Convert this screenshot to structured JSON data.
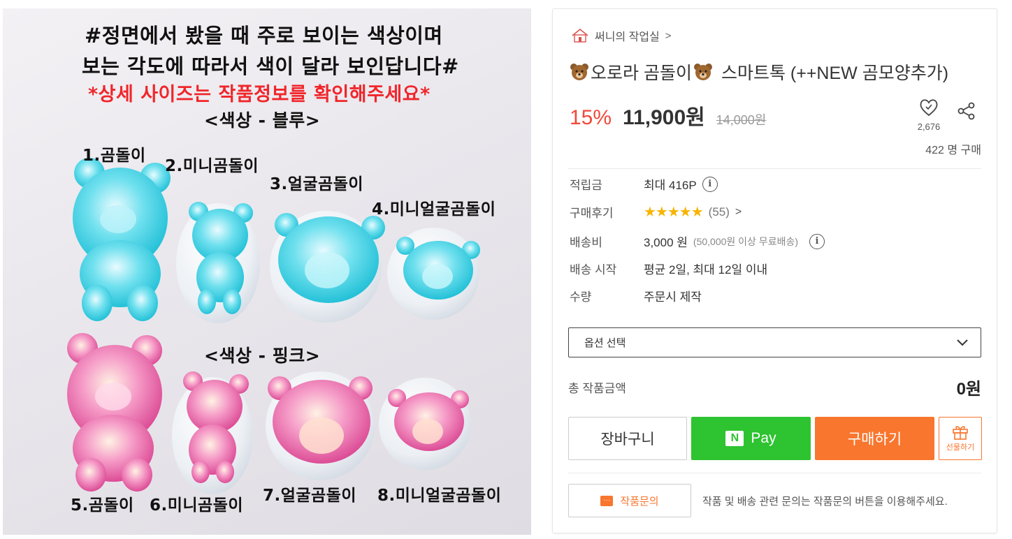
{
  "photo": {
    "line1": "#정면에서 봤을 때 주로 보이는 색상이며",
    "line2": "보는 각도에 따라서 색이 달라 보인답니다#",
    "line3": "*상세 사이즈는 작품정보를 확인해주세요*",
    "color_blue": "<색상 - 블루>",
    "color_pink": "<색상 - 핑크>",
    "labels": [
      "1.곰돌이",
      "2.미니곰돌이",
      "3.얼굴곰돌이",
      "4.미니얼굴곰돌이",
      "5.곰돌이",
      "6.미니곰돌이",
      "7.얼굴곰돌이",
      "8.미니얼굴곰돌이"
    ]
  },
  "shop": {
    "name": "써니의 작업실",
    "arrow": ">",
    "logo_icon": "house-logo-icon"
  },
  "product": {
    "title": "오로라 곰돌이",
    "title_suffix": "스마트톡 (++NEW 곰모양추가)",
    "discount": "15%",
    "price": "11,900원",
    "original_price": "14,000원",
    "likes": "2,676",
    "buyers": "422 명 구매"
  },
  "info": {
    "points_label": "적립금",
    "points_value": "최대 416P",
    "review_label": "구매후기",
    "review_stars": "★★★★★",
    "review_count": "(55)",
    "review_arrow": ">",
    "shipping_label": "배송비",
    "shipping_value": "3,000 원",
    "shipping_note": "(50,000원 이상 무료배송)",
    "dispatch_label": "배송 시작",
    "dispatch_value": "평균 2일, 최대 12일 이내",
    "qty_label": "수량",
    "qty_value": "주문시 제작"
  },
  "option_select": {
    "placeholder": "옵션 선택"
  },
  "total": {
    "label": "총 작품금액",
    "value": "0원"
  },
  "buttons": {
    "cart": "장바구니",
    "npay_n": "N",
    "npay": "Pay",
    "buy": "구매하기",
    "gift": "선물하기"
  },
  "inquiry": {
    "label": "작품문의",
    "note": "작품 및 배송 관련 문의는 작품문의 버튼을 이용해주세요."
  },
  "colors": {
    "accent": "#f8762d",
    "npay_green": "#2ec330",
    "discount_red": "#f1483a",
    "star": "#f8b400"
  }
}
